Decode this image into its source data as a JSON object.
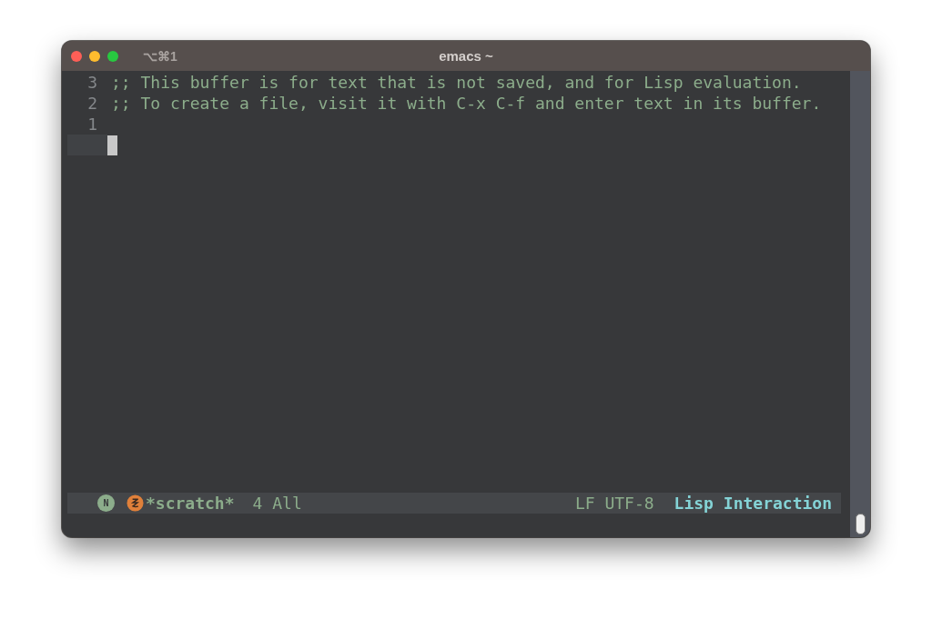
{
  "window": {
    "title": "emacs ~",
    "shortcut": "⌥⌘1"
  },
  "buffer": {
    "lines": [
      {
        "number": "3",
        "text": ";; This buffer is for text that is not saved, and for Lisp evaluation.",
        "current": false
      },
      {
        "number": "2",
        "text": ";; To create a file, visit it with C-x C-f and enter text in its buffer.",
        "current": false
      },
      {
        "number": "1",
        "current": false
      },
      {
        "current": true
      }
    ]
  },
  "mode_line": {
    "state_badge": "N",
    "buffer_name": "*scratch*",
    "position": "4 All",
    "encoding": "LF UTF-8",
    "major_mode": "Lisp Interaction"
  }
}
